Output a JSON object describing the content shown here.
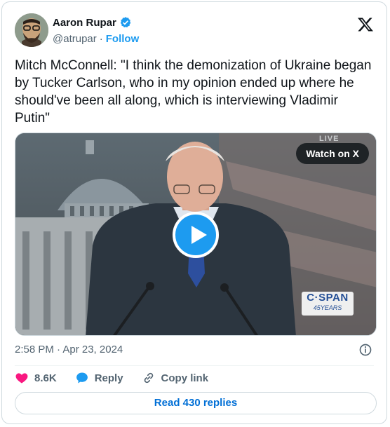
{
  "author": {
    "name": "Aaron Rupar",
    "handle": "@atrupar",
    "separator": "·",
    "follow_label": "Follow"
  },
  "tweet": {
    "text": "Mitch McConnell: \"I think the demonization of Ukraine began by Tucker Carlson, who in my opinion ended up where he should've been all along, which is interviewing Vladimir Putin\""
  },
  "media": {
    "watch_label": "Watch on X",
    "live_overlay": "LIVE",
    "network_logo": "C·SPAN",
    "network_tagline": "45YEARS"
  },
  "timestamp": "2:58 PM · Apr 23, 2024",
  "actions": {
    "likes": "8.6K",
    "reply_label": "Reply",
    "copy_label": "Copy link"
  },
  "read_replies_label": "Read 430 replies",
  "colors": {
    "accent": "#1d9bf0",
    "like": "#f91880",
    "link": "#006fd6"
  }
}
